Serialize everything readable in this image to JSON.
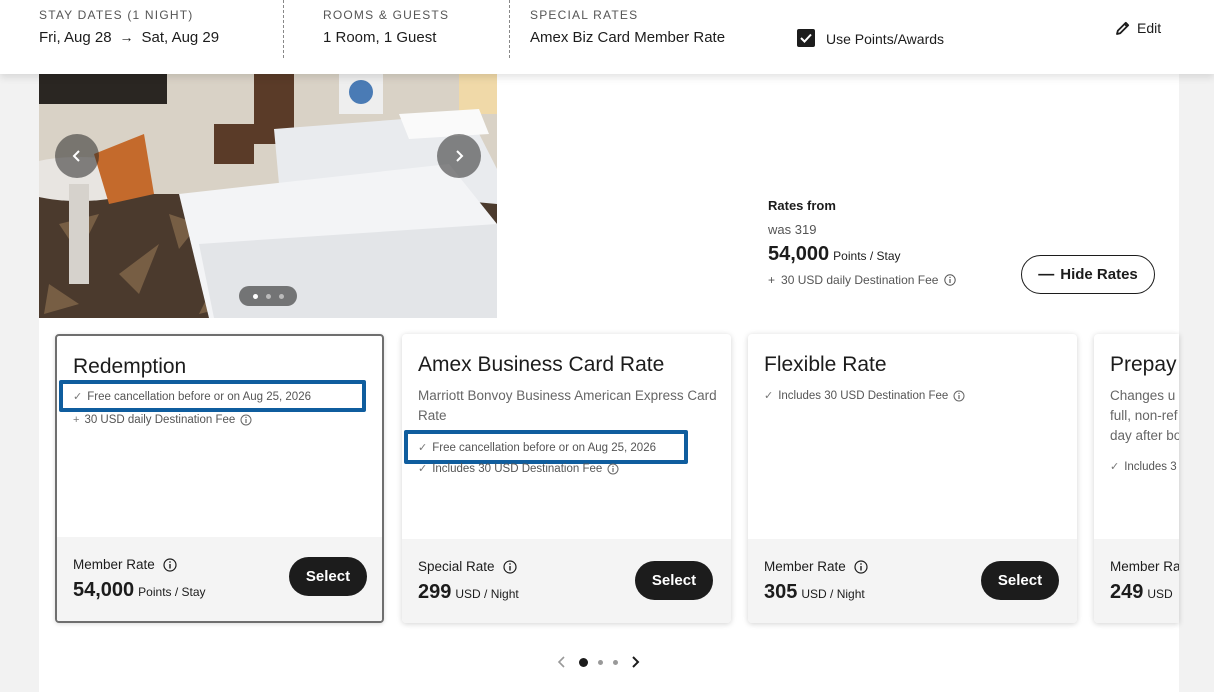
{
  "header": {
    "dates_label": "STAY DATES (1 NIGHT)",
    "check_in": "Fri, Aug 28",
    "check_out": "Sat, Aug 29",
    "rooms_label": "ROOMS & GUESTS",
    "rooms_value": "1 Room, 1 Guest",
    "special_label": "SPECIAL RATES",
    "special_value": "Amex Biz Card Member Rate",
    "use_points_label": "Use Points/Awards",
    "use_points_checked": true,
    "edit_label": "Edit"
  },
  "summary": {
    "rates_from_label": "Rates from",
    "was_text": "was 319",
    "price": "54,000",
    "price_unit": "Points / Stay",
    "fee_prefix": "+",
    "fee_text": "30 USD daily Destination Fee",
    "hide_rates_label": "Hide Rates"
  },
  "photo": {
    "dots_total": 3,
    "active_dot": 1
  },
  "cards": [
    {
      "title": "Redemption",
      "highlight": "Free cancellation before or on Aug 25, 2026",
      "feature2": "30 USD daily Destination Fee",
      "rate_label": "Member Rate",
      "price": "54,000",
      "unit": "Points / Stay",
      "select_label": "Select"
    },
    {
      "title": "Amex Business Card Rate",
      "description": "Marriott Bonvoy Business American Express Card Rate",
      "highlight": "Free cancellation before or on Aug 25, 2026",
      "feature2": "Includes 30 USD Destination Fee",
      "rate_label": "Special Rate",
      "price": "299",
      "unit": "USD / Night",
      "select_label": "Select"
    },
    {
      "title": "Flexible Rate",
      "feature1": "Includes 30 USD Destination Fee",
      "rate_label": "Member Rate",
      "price": "305",
      "unit": "USD / Night",
      "select_label": "Select"
    },
    {
      "title": "Prepay",
      "desc_lines": [
        "Changes u",
        "full, non-ref",
        "day after bo"
      ],
      "feature1": "Includes 3",
      "rate_label": "Member Ra",
      "price": "249",
      "unit": "USD"
    }
  ],
  "pager": {
    "total": 3,
    "active": 1
  },
  "colors": {
    "highlight_border": "#0f5d9e",
    "button_dark": "#1c1c1c"
  }
}
